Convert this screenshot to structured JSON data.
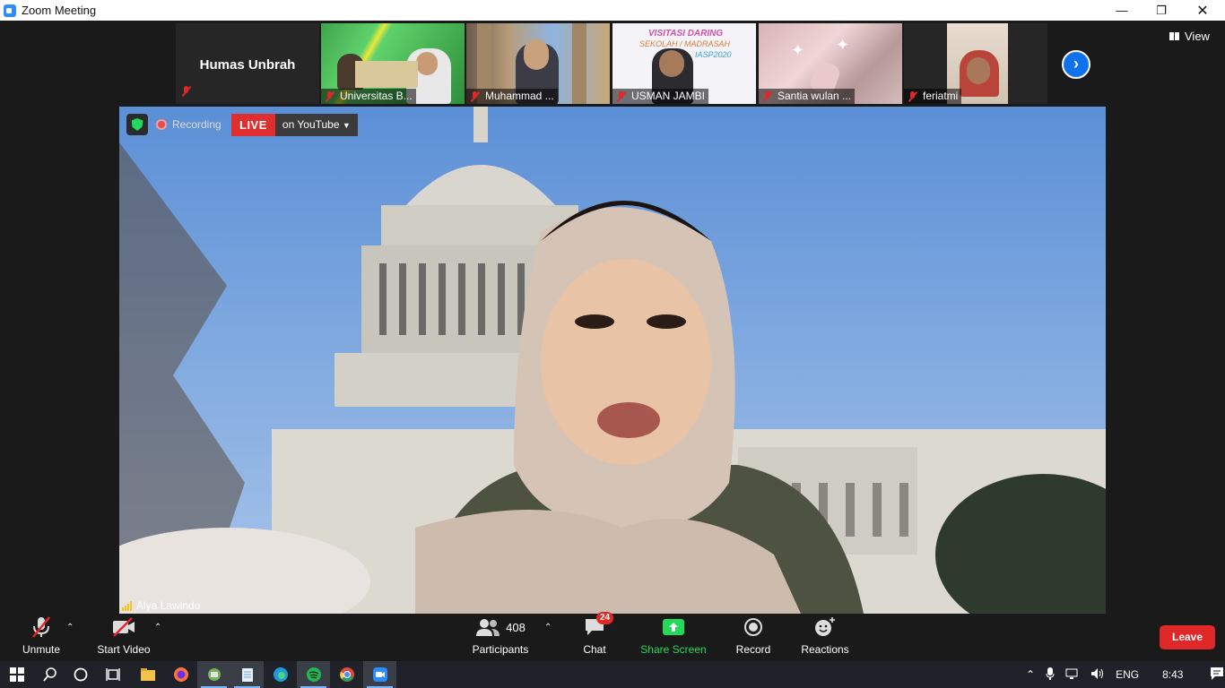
{
  "window": {
    "title": "Zoom Meeting"
  },
  "gallery": {
    "active_name": "Humas Unbrah",
    "tiles": [
      {
        "name": "Universitas B..."
      },
      {
        "name": "Muhammad ..."
      },
      {
        "name": "USMAN JAMBI"
      },
      {
        "name": "Santia wulan ..."
      },
      {
        "name": "feriatmi"
      }
    ],
    "view_label": "View"
  },
  "main_video": {
    "recording_label": "Recording",
    "live_label": "LIVE",
    "stream_label": "on YouTube",
    "speaker_name": "Alya Lawindo"
  },
  "toolbar": {
    "unmute": "Unmute",
    "start_video": "Start Video",
    "participants_label": "Participants",
    "participants_count": "408",
    "chat_label": "Chat",
    "chat_badge": "24",
    "share_label": "Share Screen",
    "record_label": "Record",
    "reactions_label": "Reactions",
    "leave_label": "Leave"
  },
  "taskbar": {
    "language": "ENG",
    "time": "8:43"
  },
  "colors": {
    "accent": "#0e72ed",
    "share_green": "#23d959",
    "leave_red": "#e02828",
    "live_red": "#e02d2d"
  }
}
